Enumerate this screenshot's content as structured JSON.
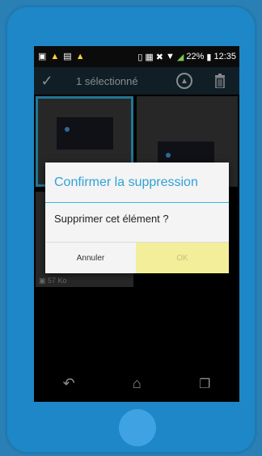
{
  "statusbar": {
    "icons": [
      "usb-icon",
      "warning-icon",
      "image-icon",
      "warning-icon",
      "vibrate-icon",
      "nfc-icon",
      "mute-icon",
      "wifi-icon",
      "signal-icon",
      "battery-icon"
    ],
    "battery": "22%",
    "time": "12:35"
  },
  "actionbar": {
    "title": "1 sélectionné"
  },
  "grid": {
    "file_size": "57 Ko"
  },
  "dialog": {
    "title": "Confirmer la suppression",
    "message": "Supprimer cet élément ?",
    "cancel_label": "Annuler",
    "ok_label": "OK"
  },
  "colors": {
    "device_body": "#1d87c8",
    "dialog_accent": "#30a2d6",
    "ok_button": "#f3ee9a"
  }
}
